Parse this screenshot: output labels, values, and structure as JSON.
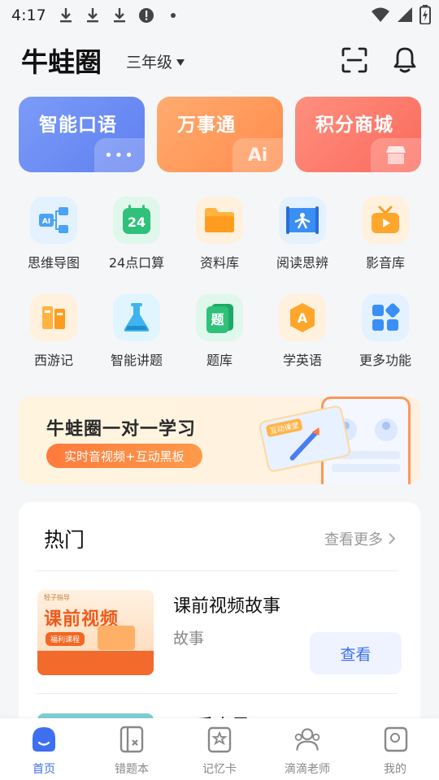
{
  "status_bar": {
    "time": "4:17"
  },
  "header": {
    "title": "牛蛙圈",
    "grade": "三年级"
  },
  "feature_cards": [
    {
      "label": "智能口语",
      "deco": "•••"
    },
    {
      "label": "万事通",
      "deco": "Ai"
    },
    {
      "label": "积分商城",
      "deco": ""
    }
  ],
  "grid": [
    {
      "label": "思维导图",
      "icon": "mind-map-icon",
      "color": "#4aa3f5",
      "icon_text": "AI"
    },
    {
      "label": "24点口算",
      "icon": "calc-24-icon",
      "color": "#2fc17a",
      "icon_text": "24"
    },
    {
      "label": "资料库",
      "icon": "folder-icon",
      "color": "#ffa62b",
      "icon_text": ""
    },
    {
      "label": "阅读思辨",
      "icon": "reading-icon",
      "color": "#3a8ff5",
      "icon_text": ""
    },
    {
      "label": "影音库",
      "icon": "video-icon",
      "color": "#ffa62b",
      "icon_text": ""
    },
    {
      "label": "西游记",
      "icon": "books-icon",
      "color": "#ffa62b",
      "icon_text": ""
    },
    {
      "label": "智能讲题",
      "icon": "flask-icon",
      "color": "#3fb4f0",
      "icon_text": ""
    },
    {
      "label": "题库",
      "icon": "question-bank-icon",
      "color": "#2fc17a",
      "icon_text": "题"
    },
    {
      "label": "学英语",
      "icon": "english-icon",
      "color": "#ffa62b",
      "icon_text": "A"
    },
    {
      "label": "更多功能",
      "icon": "more-apps-icon",
      "color": "#3a8ff5",
      "icon_text": ""
    }
  ],
  "banner": {
    "title": "牛蛙圈一对一学习",
    "pill": "实时音视频+互动黑板",
    "card_tag": "互动课堂"
  },
  "hot": {
    "title": "热门",
    "more": "查看更多",
    "item": {
      "thumb_brand": "轻子指导",
      "thumb_title": "课前视频",
      "thumb_tag": "福利课程",
      "title": "课前视频故事",
      "subtitle": "故事",
      "button": "查看"
    },
    "peek_title": "手末界"
  },
  "nav": [
    {
      "label": "首页",
      "active": true
    },
    {
      "label": "错题本",
      "active": false
    },
    {
      "label": "记忆卡",
      "active": false
    },
    {
      "label": "滴滴老师",
      "active": false
    },
    {
      "label": "我的",
      "active": false
    }
  ],
  "colors": {
    "accent": "#3d6ff0",
    "orange": "#ff8c4c"
  }
}
